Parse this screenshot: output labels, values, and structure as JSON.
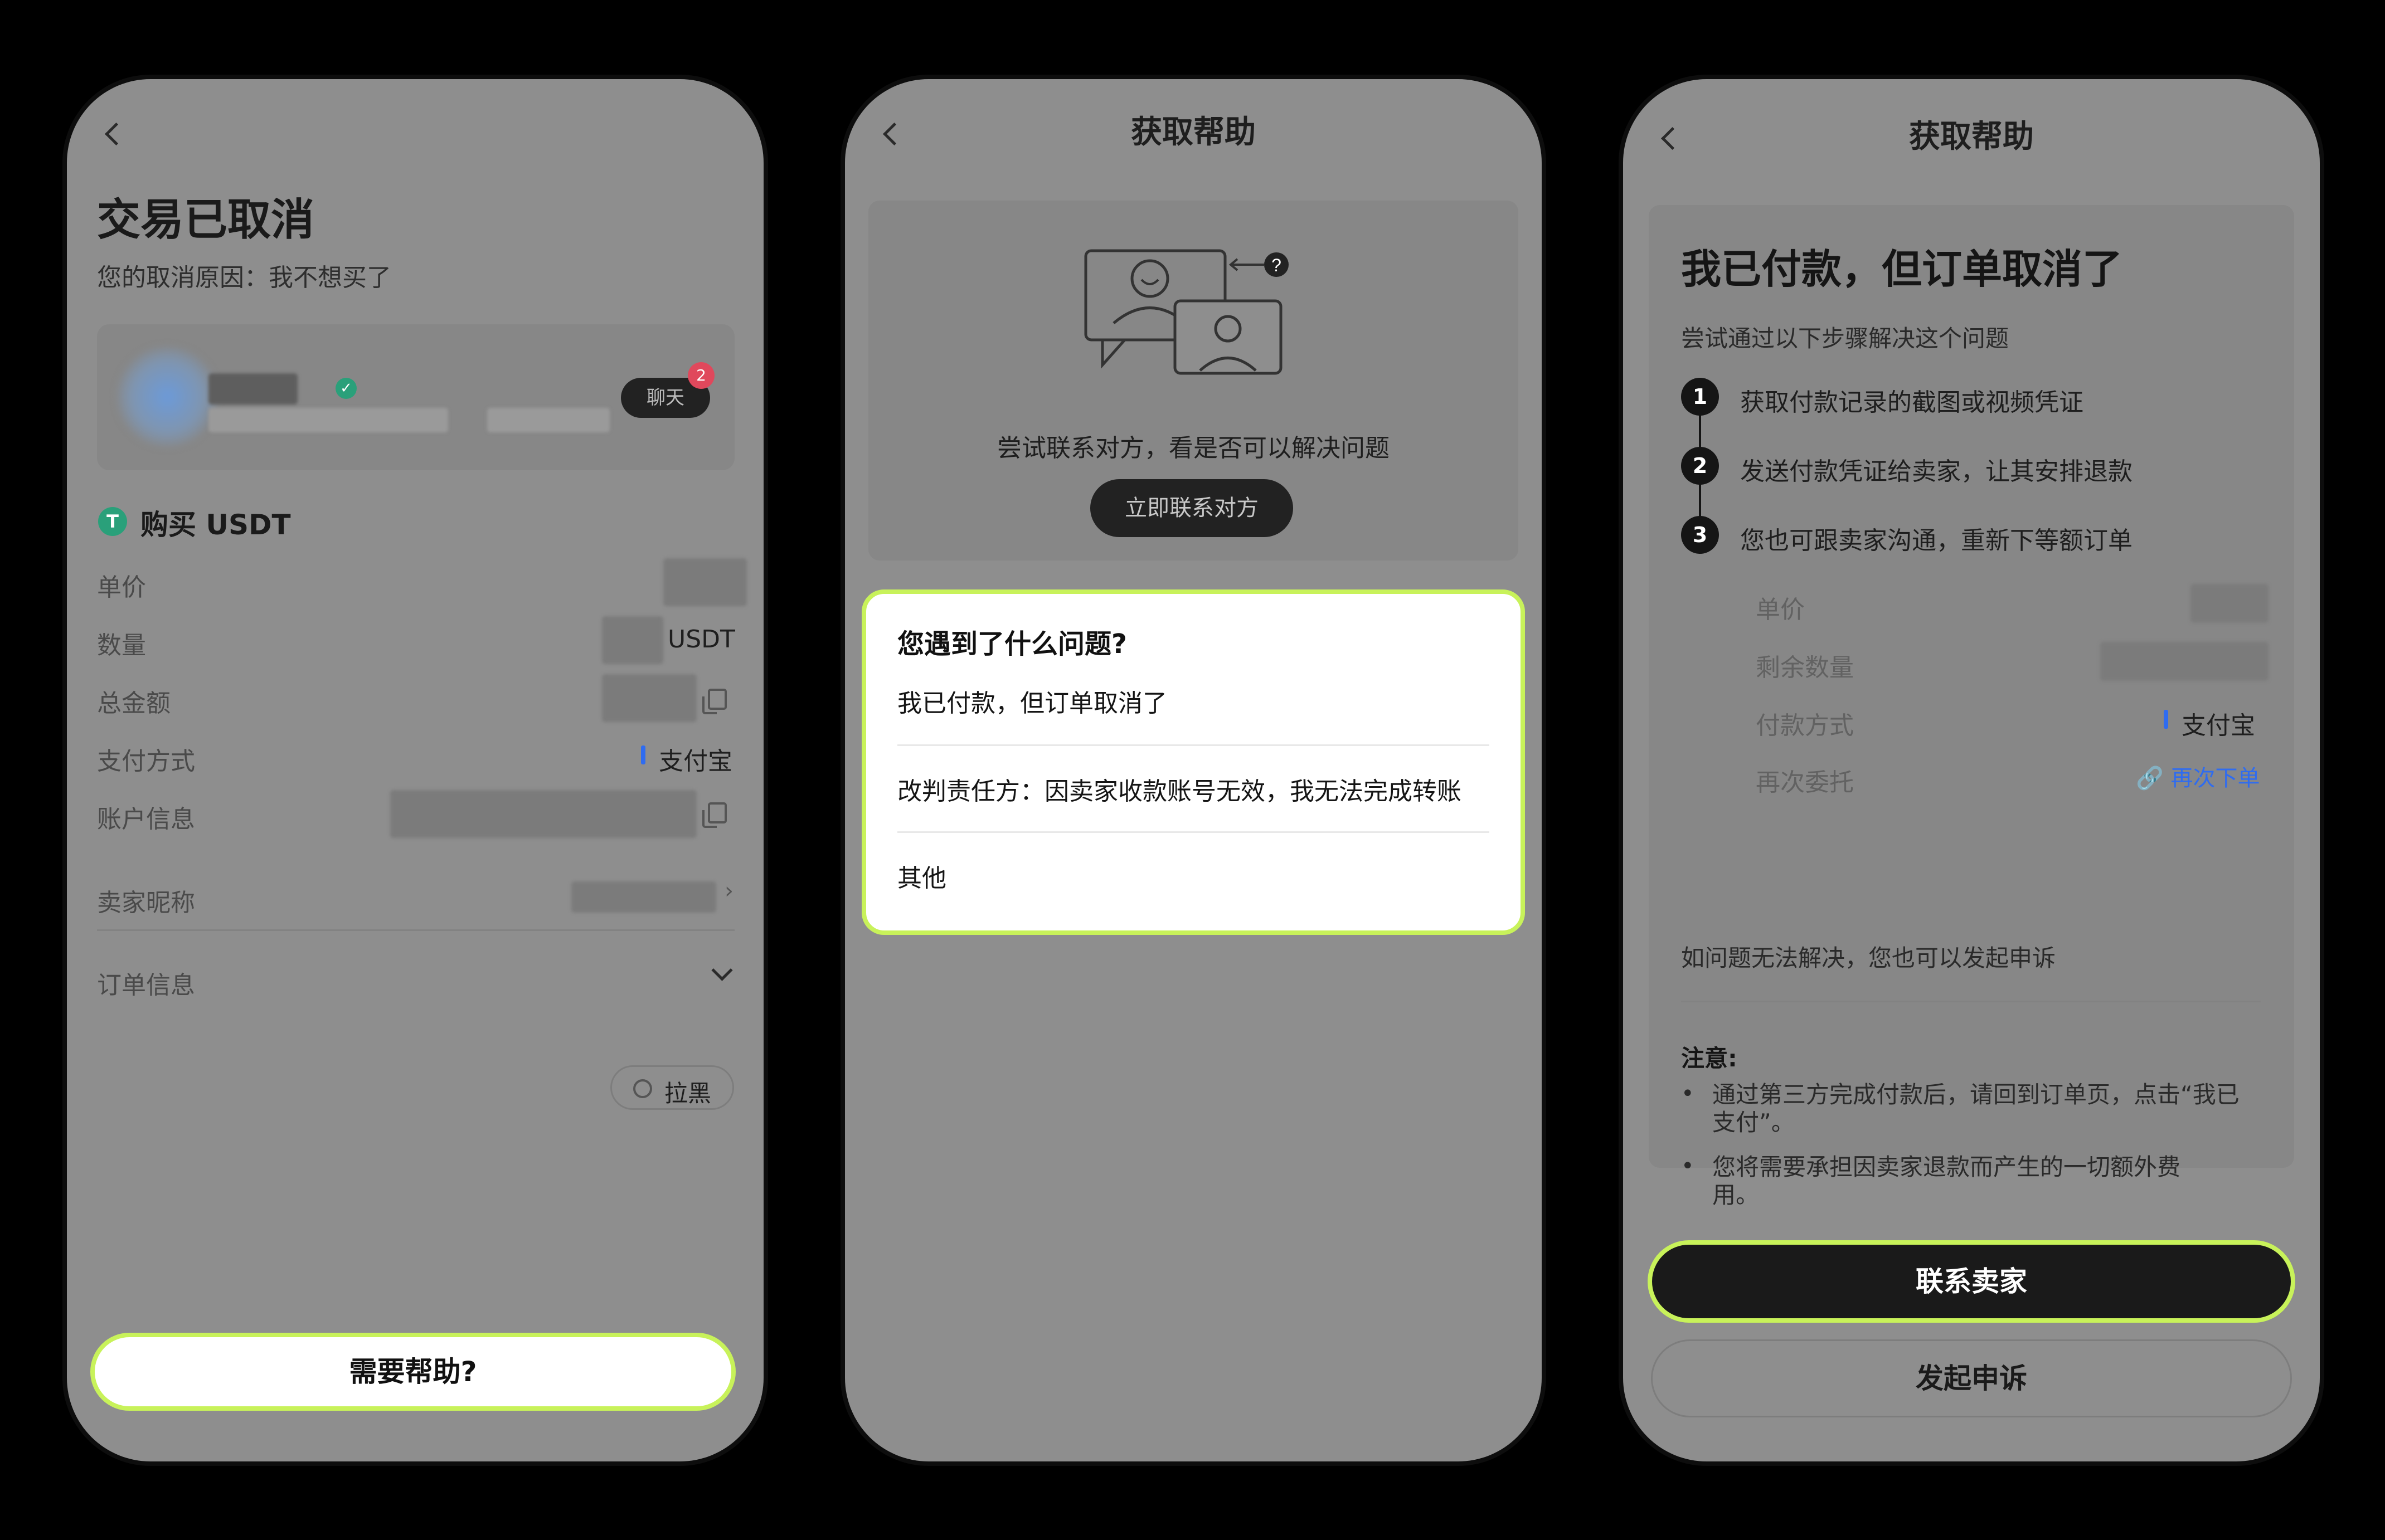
{
  "screen1": {
    "title": "交易已取消",
    "reason": "您的取消原因：我不想买了",
    "chat_label": "聊天",
    "chat_badge": "2",
    "buy_label": "购买 USDT",
    "rows": [
      {
        "label": "单价",
        "value": ""
      },
      {
        "label": "数量",
        "value": "USDT"
      },
      {
        "label": "总金额",
        "value": ""
      },
      {
        "label": "支付方式",
        "value": "支付宝"
      },
      {
        "label": "账户信息",
        "value": ""
      }
    ],
    "seller_nick_label": "卖家昵称",
    "order_info_label": "订单信息",
    "block_label": "拉黑",
    "help_button": "需要帮助?"
  },
  "screen2": {
    "title": "获取帮助",
    "contact_hint": "尝试联系对方，看是否可以解决问题",
    "contact_button": "立即联系对方",
    "popup_title": "您遇到了什么问题?",
    "options": [
      "我已付款，但订单取消了",
      "改判责任方：因卖家收款账号无效，我无法完成转账",
      "其他"
    ]
  },
  "screen3": {
    "title": "获取帮助",
    "heading": "我已付款，但订单取消了",
    "subheading": "尝试通过以下步骤解决这个问题",
    "steps": [
      {
        "num": "1",
        "text": "获取付款记录的截图或视频凭证"
      },
      {
        "num": "2",
        "text": "发送付款凭证给卖家，让其安排退款"
      },
      {
        "num": "3",
        "text": "您也可跟卖家沟通，重新下等额订单"
      }
    ],
    "details": [
      {
        "label": "单价",
        "value": ""
      },
      {
        "label": "剩余数量",
        "value": ""
      },
      {
        "label": "付款方式",
        "value": "支付宝"
      },
      {
        "label": "再次委托",
        "value": "再次下单"
      }
    ],
    "appeal_hint": "如问题无法解决，您也可以发起申诉",
    "note_title": "注意:",
    "notes": [
      "通过第三方完成付款后，请回到订单页，点击“我已支付”。",
      "您将需要承担因卖家退款而产生的一切额外费用。"
    ],
    "contact_seller_button": "联系卖家",
    "appeal_button": "发起申诉"
  },
  "colors": {
    "highlight": "#c8f25a",
    "tether_green": "#2aa07a",
    "alipay_blue": "#2f6cf0",
    "badge_red": "#e0485c"
  },
  "icons": [
    "back-icon",
    "tether-icon",
    "verified-icon",
    "copy-icon",
    "chevron-right-icon",
    "chevron-down-icon",
    "block-icon",
    "chat-help-illustration",
    "link-icon"
  ]
}
